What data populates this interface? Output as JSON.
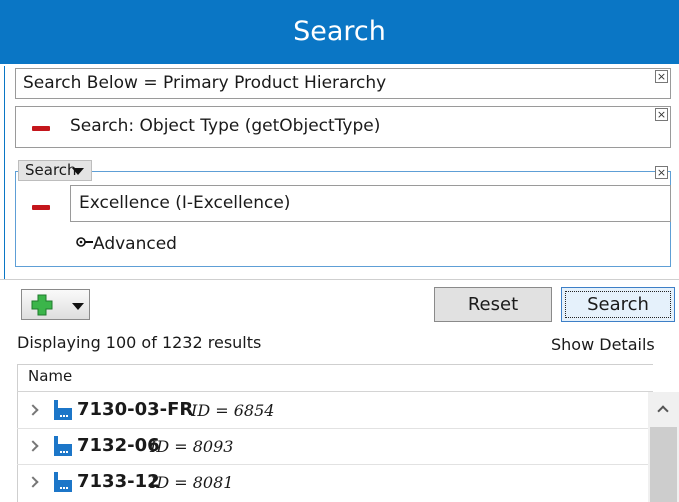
{
  "header": {
    "title": "Search"
  },
  "criteria": [
    {
      "text": "Search Below = Primary Product Hierarchy",
      "close": "×"
    },
    {
      "text": "Search: Object Type (getObjectType)",
      "close": "×"
    }
  ],
  "group": {
    "dropdown_label": "Search",
    "close": "×",
    "value": "Excellence (I-Excellence)",
    "advanced_label": "Advanced"
  },
  "toolbar": {
    "reset_label": "Reset",
    "search_label": "Search"
  },
  "results": {
    "status": "Displaying 100 of 1232 results",
    "show_details": "Show Details",
    "columns": [
      "Name"
    ],
    "rows": [
      {
        "code": "7130-03-FR",
        "id": "ID = 6854"
      },
      {
        "code": "7132-06",
        "id": "ID = 8093"
      },
      {
        "code": "7133-12",
        "id": "ID = 8081"
      }
    ]
  },
  "colors": {
    "accent": "#0a76c5",
    "remove": "#c4161c",
    "add": "#3bb54a"
  },
  "icons": [
    "close-icon",
    "minus-icon",
    "key-icon",
    "add-icon",
    "chevron-right-icon",
    "product-icon",
    "scroll-up-icon"
  ]
}
